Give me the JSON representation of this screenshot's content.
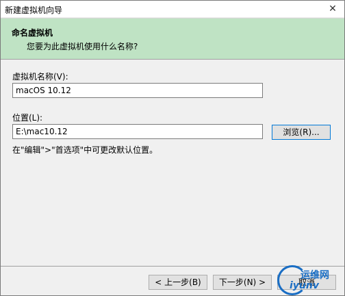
{
  "window": {
    "title": "新建虚拟机向导",
    "close_glyph": "✕"
  },
  "header": {
    "title": "命名虚拟机",
    "subtitle": "您要为此虚拟机使用什么名称?"
  },
  "vm_name": {
    "label": "虚拟机名称(V):",
    "value": "macOS 10.12"
  },
  "location": {
    "label": "位置(L):",
    "value": "E:\\mac10.12",
    "browse_label": "浏览(R)..."
  },
  "hint": "在\"编辑\">\"首选项\"中可更改默认位置。",
  "footer": {
    "back_label": "< 上一步(B)",
    "next_label": "下一步(N) >",
    "cancel_label": "取消"
  },
  "watermark": {
    "top": "运维网",
    "bottom": "iyunv"
  }
}
